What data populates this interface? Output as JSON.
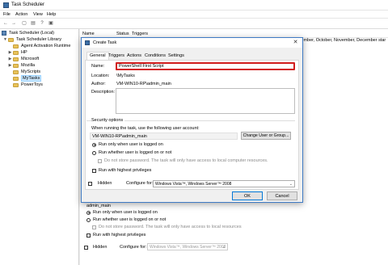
{
  "window": {
    "title": "Task Scheduler"
  },
  "menu": [
    "File",
    "Action",
    "View",
    "Help"
  ],
  "toolbar_icons": [
    "back-arrow-icon",
    "forward-arrow-icon",
    "folder-up-icon",
    "properties-icon",
    "help-icon",
    "view-pane-icon"
  ],
  "tree": {
    "root": "Task Scheduler (Local)",
    "library": "Task Scheduler Library",
    "items": [
      "Agent Activation Runtime",
      "HP",
      "Microsoft",
      "Mozilla",
      "MyScripts",
      "MyTasks",
      "PowerToys"
    ],
    "selected": "MyTasks"
  },
  "list": {
    "columns": [
      "Name",
      "Status",
      "Triggers"
    ],
    "trigger_text": "september, October, November, December star"
  },
  "background_panel": {
    "account": "admin_main",
    "run_logged_on": "Run only when user is logged on",
    "run_whether": "Run whether user is logged on or not",
    "no_store_password": "Do not store password.  The task will only have access to local resources",
    "highest_privileges": "Run with highest privileges",
    "hidden": "Hidden",
    "configure_for_label": "Configure for:",
    "configure_for_value": "Windows Vista™, Windows Server™ 2008"
  },
  "dialog": {
    "title": "Create Task",
    "close_glyph": "✕",
    "tabs": [
      "General",
      "Triggers",
      "Actions",
      "Conditions",
      "Settings"
    ],
    "active_tab": "General",
    "name_label": "Name:",
    "name_value": "PowerShell First Script",
    "location_label": "Location:",
    "location_value": "\\MyTasks",
    "author_label": "Author:",
    "author_value": "VM-WIN10-RP\\admin_main",
    "description_label": "Description:",
    "description_value": "",
    "security_heading": "Security options",
    "account_prompt": "When running the task, use the following user account:",
    "account_value": "VM-WIN10-RP\\admin_main",
    "change_user_button": "Change User or Group...",
    "run_logged_on": "Run only when user is logged on",
    "run_whether": "Run whether user is logged on or not",
    "no_store_password": "Do not store password.  The task will only have access to local computer resources.",
    "highest_privileges": "Run with highest privileges",
    "hidden": "Hidden",
    "configure_for_label": "Configure for:",
    "configure_for_value": "Windows Vista™, Windows Server™ 2008",
    "ok_button": "OK",
    "cancel_button": "Cancel"
  }
}
